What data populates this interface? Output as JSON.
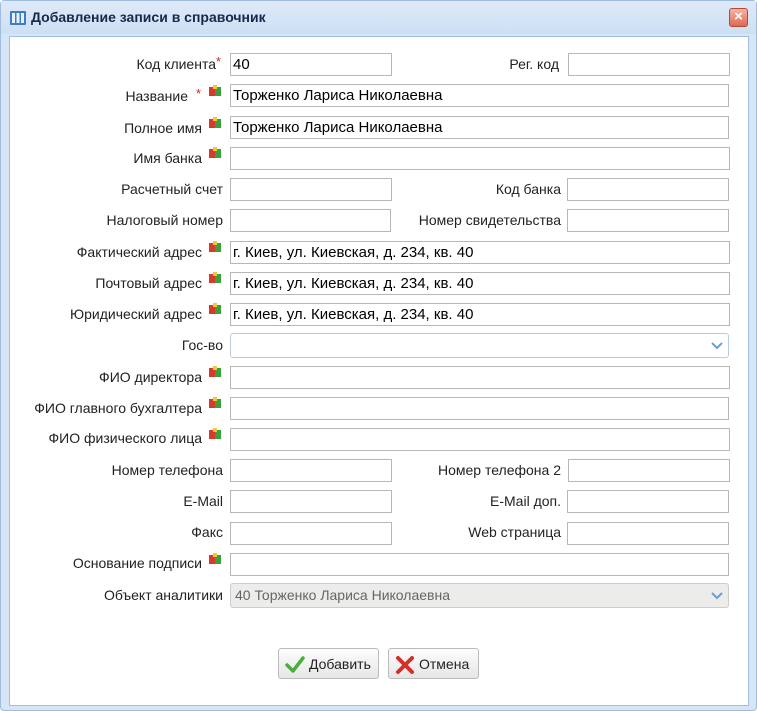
{
  "window": {
    "title": "Добавление записи в справочник",
    "close_symbol": "×"
  },
  "form": {
    "client_code": {
      "label": "Код клиента",
      "value": "40",
      "required_mark": "*"
    },
    "reg_code": {
      "label": "Рег. код",
      "value": ""
    },
    "name": {
      "label": "Название",
      "value": "Торженко Лариса Николаевна",
      "required_mark": "*"
    },
    "full_name": {
      "label": "Полное имя",
      "value": "Торженко Лариса Николаевна"
    },
    "bank_name": {
      "label": "Имя банка",
      "value": ""
    },
    "account": {
      "label": "Расчетный счет",
      "value": ""
    },
    "bank_code": {
      "label": "Код банка",
      "value": ""
    },
    "tax_number": {
      "label": "Налоговый номер",
      "value": ""
    },
    "certificate_number": {
      "label": "Номер свидетельства",
      "value": ""
    },
    "actual_address": {
      "label": "Фактический адрес",
      "value": "г. Киев, ул. Киевская, д. 234, кв. 40"
    },
    "postal_address": {
      "label": "Почтовый адрес",
      "value": "г. Киев, ул. Киевская, д. 234, кв. 40"
    },
    "legal_address": {
      "label": "Юридический адрес",
      "value": "г. Киев, ул. Киевская, д. 234, кв. 40"
    },
    "country": {
      "label": "Гос-во",
      "value": ""
    },
    "director": {
      "label": "ФИО директора",
      "value": ""
    },
    "chief_accountant": {
      "label": "ФИО главного бухгалтера",
      "value": ""
    },
    "individual": {
      "label": "ФИО физического лица",
      "value": ""
    },
    "phone": {
      "label": "Номер телефона",
      "value": ""
    },
    "phone2": {
      "label": "Номер телефона 2",
      "value": ""
    },
    "email": {
      "label": "E-Mail",
      "value": ""
    },
    "email_extra": {
      "label": "E-Mail доп.",
      "value": ""
    },
    "fax": {
      "label": "Факс",
      "value": ""
    },
    "web": {
      "label": "Web страница",
      "value": ""
    },
    "signature_basis": {
      "label": "Основание подписи",
      "value": ""
    },
    "analytics_object": {
      "label": "Объект аналитики",
      "value": "40 Торженко Лариса Николаевна"
    }
  },
  "buttons": {
    "add": "Добавить",
    "cancel": "Отмена"
  },
  "colors": {
    "title_bar": "#cddff4",
    "required": "#dd2222",
    "add_icon": "#4cae3c",
    "cancel_icon": "#d4302a",
    "combo_arrow": "#6b9fd6"
  },
  "icons": {
    "translate": "translate-icon",
    "window": "directory-icon",
    "add": "check-icon",
    "cancel": "cross-icon",
    "dropdown": "chevron-down-icon"
  }
}
